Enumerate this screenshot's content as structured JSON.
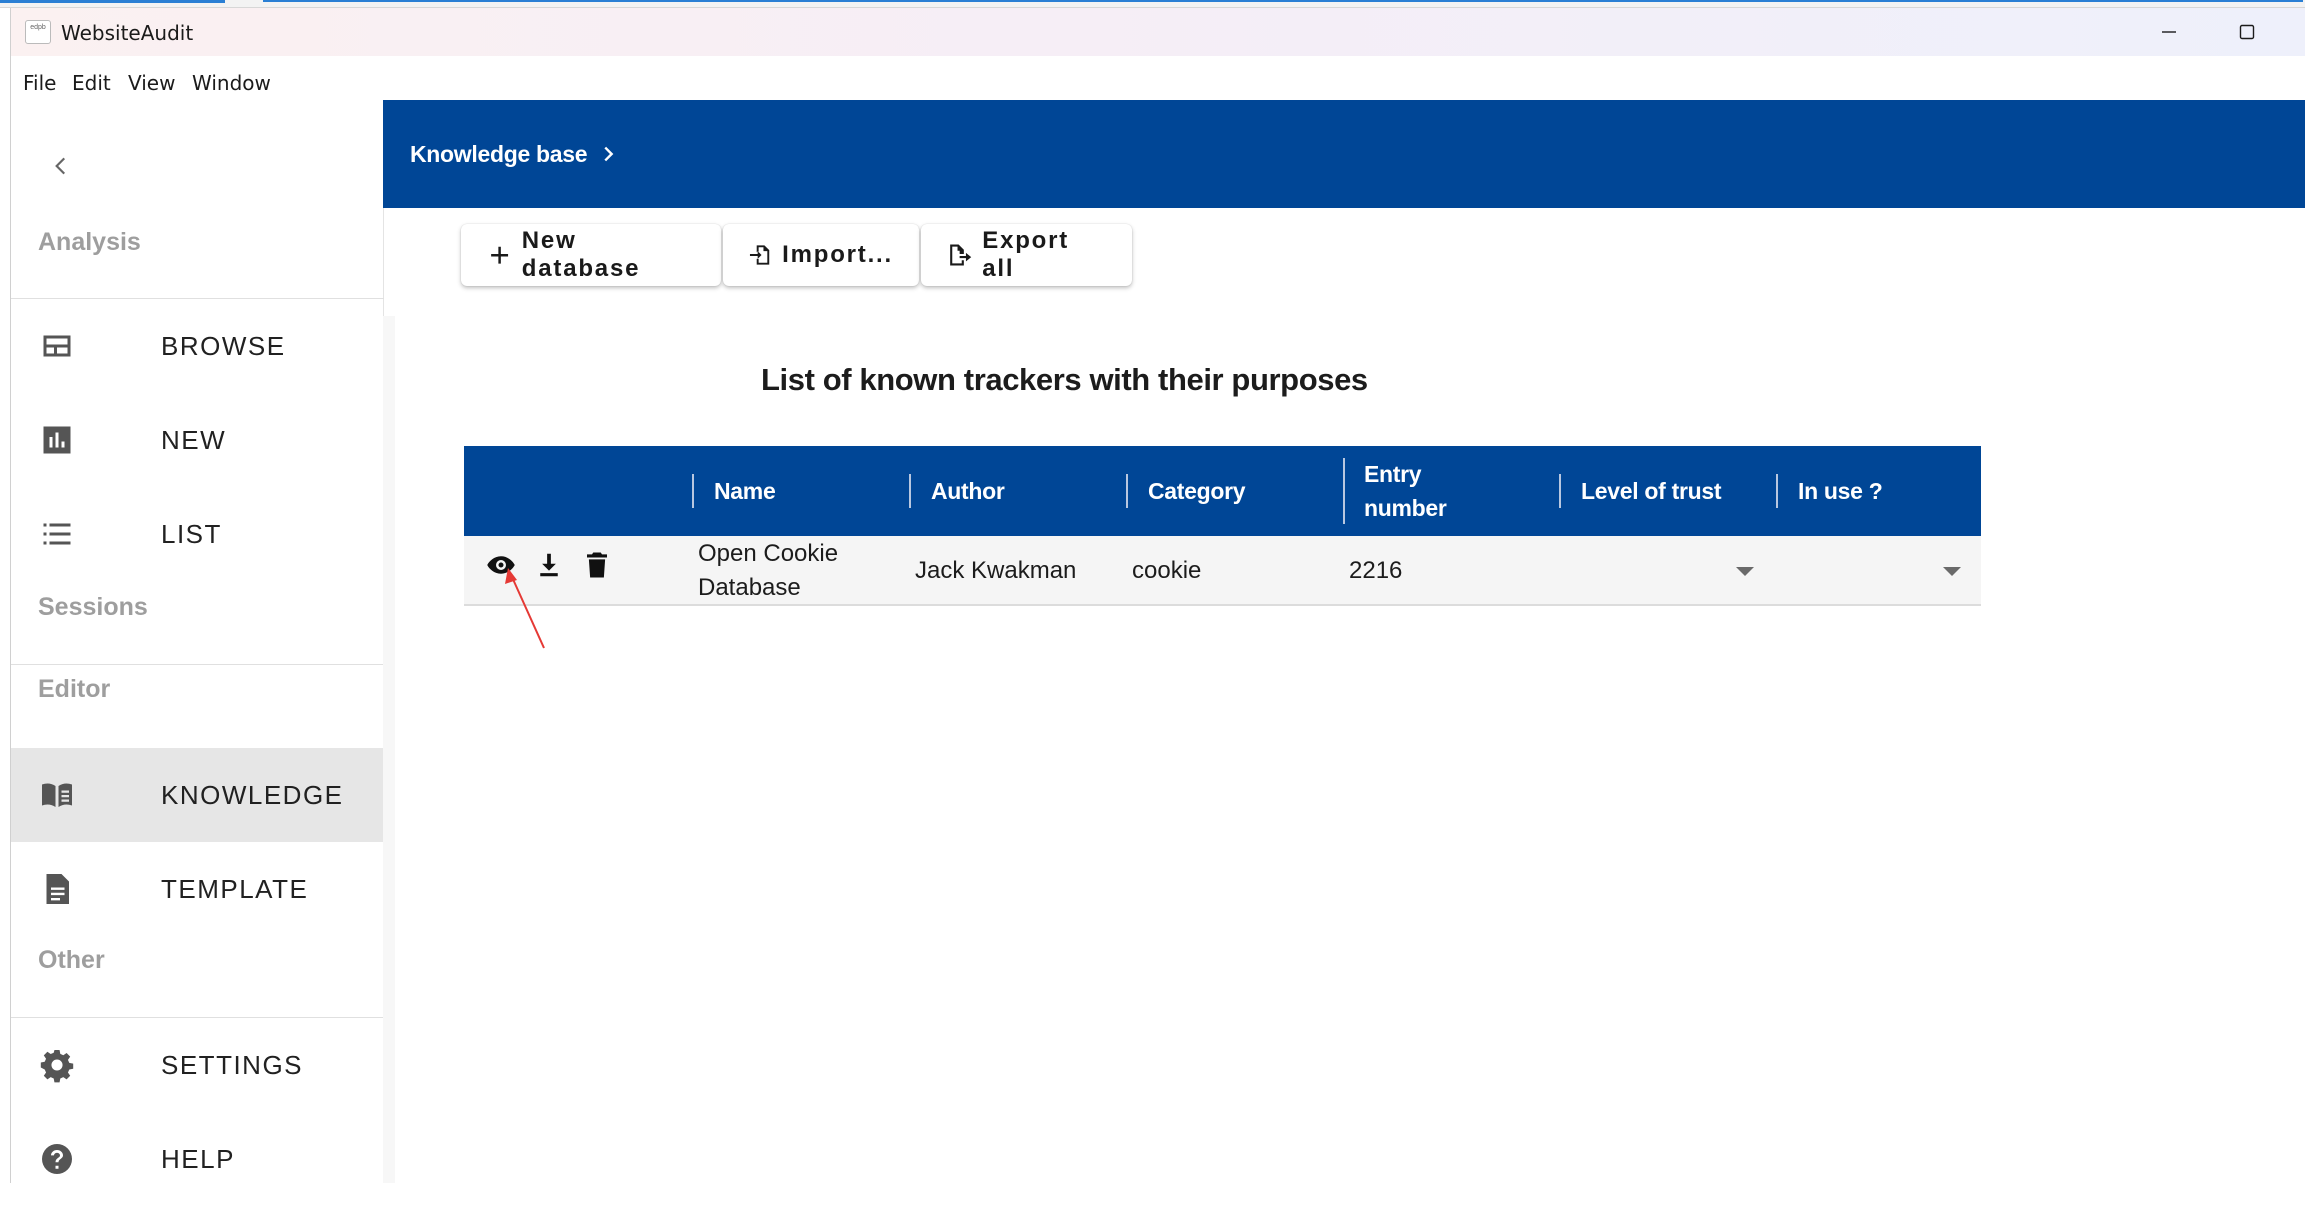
{
  "window": {
    "title": "WebsiteAudit",
    "logo_text": "edpb"
  },
  "menubar": {
    "items": [
      {
        "label": "File"
      },
      {
        "label": "Edit"
      },
      {
        "label": "View"
      },
      {
        "label": "Window"
      }
    ]
  },
  "sidebar": {
    "sections": {
      "analysis": "Analysis",
      "sessions": "Sessions",
      "editor": "Editor",
      "other": "Other"
    },
    "items": [
      {
        "label": "BROWSE",
        "icon": "browse-icon"
      },
      {
        "label": "NEW",
        "icon": "bar-chart-icon"
      },
      {
        "label": "LIST",
        "icon": "list-icon"
      },
      {
        "label": "KNOWLEDGE",
        "icon": "book-icon",
        "active": true
      },
      {
        "label": "TEMPLATE",
        "icon": "document-icon"
      },
      {
        "label": "SETTINGS",
        "icon": "gear-icon"
      },
      {
        "label": "HELP",
        "icon": "help-icon"
      }
    ]
  },
  "header": {
    "breadcrumb": "Knowledge base"
  },
  "toolbar": {
    "new_label": "New database",
    "import_label": "Import...",
    "export_label": "Export all"
  },
  "table": {
    "title": "List of known trackers with their purposes",
    "columns": [
      "Name",
      "Author",
      "Category",
      "Entry number",
      "Level of trust",
      "In use ?"
    ],
    "rows": [
      {
        "name": "Open Cookie Database",
        "author": "Jack Kwakman",
        "category": "cookie",
        "entry_number": "2216",
        "level_of_trust": "",
        "in_use": ""
      }
    ]
  },
  "colors": {
    "header_blue": "#004696",
    "active_nav": "#e6e6e6",
    "annotation_arrow": "#e53935"
  }
}
